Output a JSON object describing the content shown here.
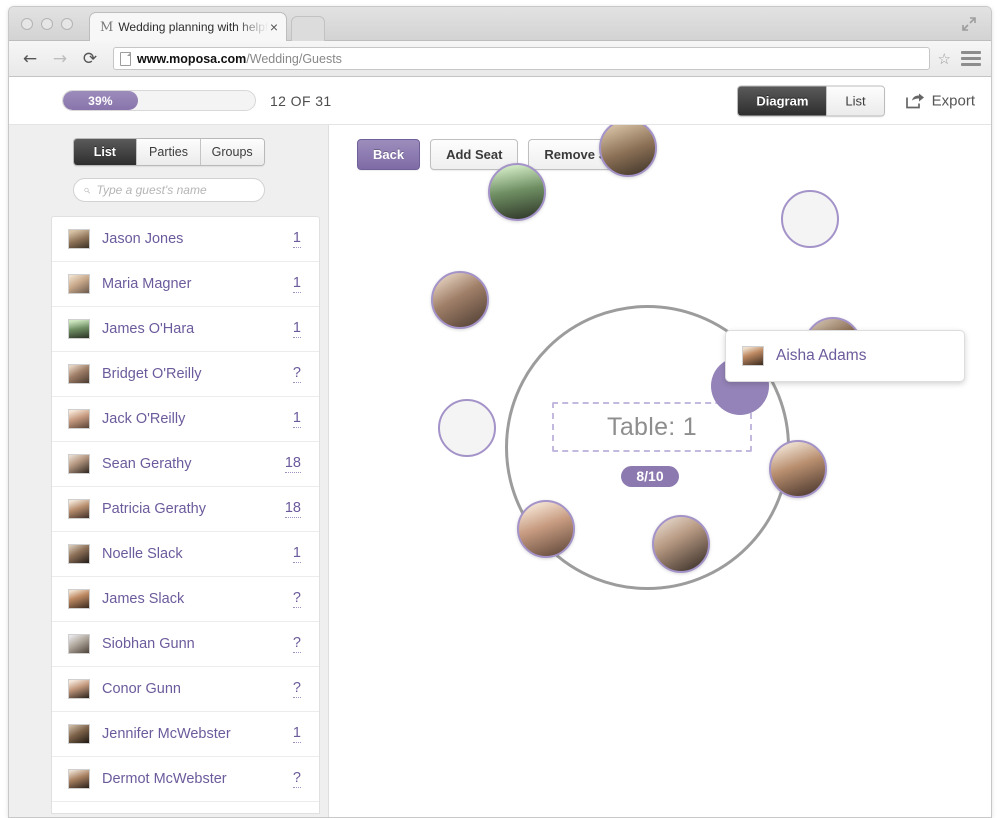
{
  "browser": {
    "tab_title": "Wedding planning with helpf",
    "tab_favicon": "M",
    "tab_close": "×",
    "back_icon": "←",
    "forward_icon": "→",
    "reload_icon": "⟳",
    "url_bold": "www.moposa.com",
    "url_rest": "/Wedding/Guests",
    "star_icon": "☆"
  },
  "topbar": {
    "progress_label": "39%",
    "progress_percent": 39,
    "progress_count": "12 OF 31",
    "view_toggle": [
      {
        "label": "Diagram",
        "active": true
      },
      {
        "label": "List",
        "active": false
      }
    ],
    "export_label": "Export"
  },
  "sidebar": {
    "tabs": [
      {
        "label": "List",
        "active": true
      },
      {
        "label": "Parties",
        "active": false
      },
      {
        "label": "Groups",
        "active": false
      }
    ],
    "search_placeholder": "Type a guest's name",
    "search_value": "",
    "guests": [
      {
        "name": "Jason Jones",
        "count": "1"
      },
      {
        "name": "Maria Magner",
        "count": "1"
      },
      {
        "name": "James O'Hara",
        "count": "1"
      },
      {
        "name": "Bridget O'Reilly",
        "count": "?"
      },
      {
        "name": "Jack O'Reilly",
        "count": "1"
      },
      {
        "name": "Sean Gerathy",
        "count": "18"
      },
      {
        "name": "Patricia Gerathy",
        "count": "18"
      },
      {
        "name": "Noelle Slack",
        "count": "1"
      },
      {
        "name": "James Slack",
        "count": "?"
      },
      {
        "name": "Siobhan Gunn",
        "count": "?"
      },
      {
        "name": "Conor Gunn",
        "count": "?"
      },
      {
        "name": "Jennifer McWebster",
        "count": "1"
      },
      {
        "name": "Dermot McWebster",
        "count": "?"
      }
    ]
  },
  "diagram": {
    "buttons": [
      {
        "label": "Back",
        "primary": true
      },
      {
        "label": "Add Seat",
        "primary": false
      },
      {
        "label": "Remove Seat",
        "primary": false
      }
    ],
    "table_name": "Table: 1",
    "seat_count_badge": "8/10",
    "seats_filled": 8,
    "seats_total": 10,
    "tooltip_name": "Aisha Adams"
  },
  "colors": {
    "accent_purple": "#8c79b0",
    "seat_ring": "#a493c8",
    "name_text": "#6c5b9c",
    "table_ring": "#9c9c9c",
    "sidebar_bg": "#efefef"
  }
}
